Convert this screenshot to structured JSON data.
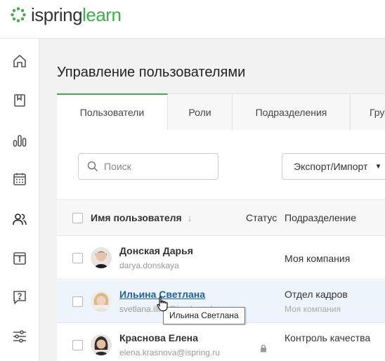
{
  "brand": {
    "logo_part1": "ispring",
    "logo_part2": "learn",
    "accent": "#3fae49"
  },
  "sidebar": {
    "items": [
      {
        "icon": "home-icon"
      },
      {
        "icon": "book-icon"
      },
      {
        "icon": "bar-chart-icon"
      },
      {
        "icon": "calendar-icon"
      },
      {
        "icon": "users-icon",
        "active": true
      },
      {
        "icon": "info-icon"
      },
      {
        "icon": "help-icon"
      },
      {
        "icon": "settings-sliders-icon"
      }
    ]
  },
  "page": {
    "title": "Управление пользователями"
  },
  "tabs": [
    "Пользователи",
    "Роли",
    "Подразделения",
    "Гру"
  ],
  "search": {
    "placeholder": "Поиск"
  },
  "export": {
    "label": "Экспорт/Импорт"
  },
  "table": {
    "headers": {
      "name": "Имя пользователя",
      "status": "Статус",
      "department": "Подразделение"
    },
    "rows": [
      {
        "name": "Донская Дарья",
        "login": "darya.donskaya",
        "department": "Моя компания",
        "department_sub": ""
      },
      {
        "name": "Ильина Светлана",
        "login": "svetlana.ilina@ispringsolu",
        "department": "Отдел кадров",
        "department_sub": "Моя компания"
      },
      {
        "name": "Краснова Елена",
        "login": "elena.krasnova@ispring.ru",
        "department": "Контроль качества",
        "department_sub": ""
      }
    ]
  },
  "tooltip": {
    "text": "Ильина Светлана"
  }
}
